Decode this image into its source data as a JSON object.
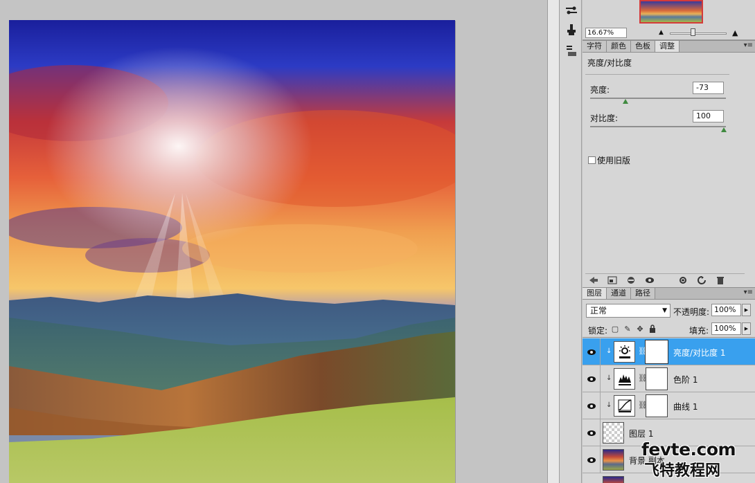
{
  "navigator": {
    "zoom": "16.67%"
  },
  "panel_tabs": [
    {
      "label": "字符",
      "active": false
    },
    {
      "label": "颜色",
      "active": false
    },
    {
      "label": "色板",
      "active": false
    },
    {
      "label": "调整",
      "active": true
    }
  ],
  "adjustments": {
    "title": "亮度/对比度",
    "brightness_label": "亮度:",
    "brightness_value": "-73",
    "contrast_label": "对比度:",
    "contrast_value": "100",
    "legacy_label": "使用旧版"
  },
  "layer_tabs": [
    {
      "label": "图层",
      "active": true
    },
    {
      "label": "通道",
      "active": false
    },
    {
      "label": "路径",
      "active": false
    }
  ],
  "layers_panel": {
    "blend_mode": "正常",
    "opacity_label": "不透明度:",
    "opacity_value": "100%",
    "lock_label": "锁定:",
    "fill_label": "填充:",
    "fill_value": "100%"
  },
  "layers": [
    {
      "name": "亮度/对比度 1",
      "type": "brightness-contrast",
      "selected": true
    },
    {
      "name": "色阶 1",
      "type": "levels",
      "selected": false
    },
    {
      "name": "曲线 1",
      "type": "curves",
      "selected": false
    },
    {
      "name": "图层 1",
      "type": "pixel-transparent",
      "selected": false
    },
    {
      "name": "背景 副本",
      "type": "pixel-photo",
      "selected": false
    }
  ],
  "watermark": {
    "url": "fevte.com",
    "name": "飞特教程网"
  },
  "colors": {
    "selection": "#39a0ee",
    "panel_bg": "#d6d6d6",
    "canvas_bg": "#c4c4c4",
    "slider_thumb": "#3f8a3f"
  }
}
